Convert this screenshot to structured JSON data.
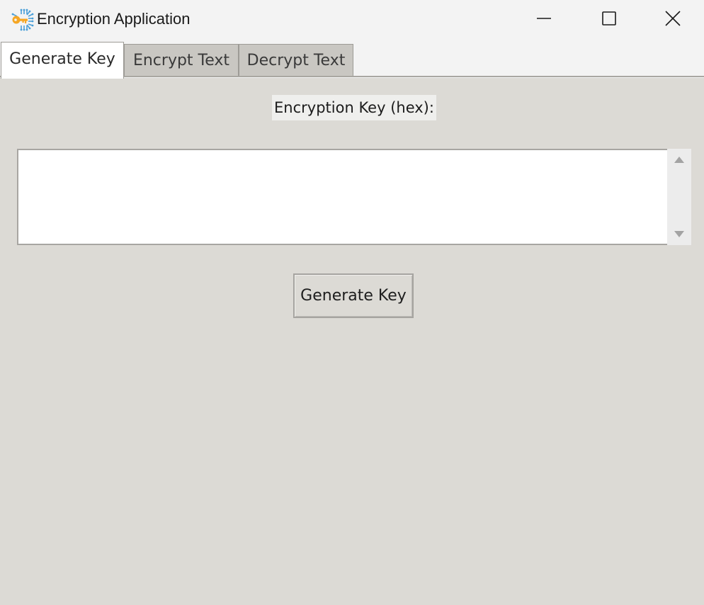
{
  "window": {
    "title": "Encryption Application",
    "app_icon": "key-circuit-icon",
    "controls": {
      "minimize_icon": "minimize-icon",
      "maximize_icon": "maximize-icon",
      "close_icon": "close-icon"
    }
  },
  "tabs": [
    {
      "label": "Generate Key",
      "active": true
    },
    {
      "label": "Encrypt Text",
      "active": false
    },
    {
      "label": "Decrypt Text",
      "active": false
    }
  ],
  "generate_key_tab": {
    "key_label": "Encryption Key (hex):",
    "key_value": "",
    "button_label": "Generate Key"
  },
  "colors": {
    "background": "#dcdad5",
    "titlebar": "#f3f3f3",
    "active_tab": "#ffffff",
    "inactive_tab": "#c9c7c2",
    "icon_key": "#f5a623",
    "icon_circuit": "#4a9fd8"
  }
}
